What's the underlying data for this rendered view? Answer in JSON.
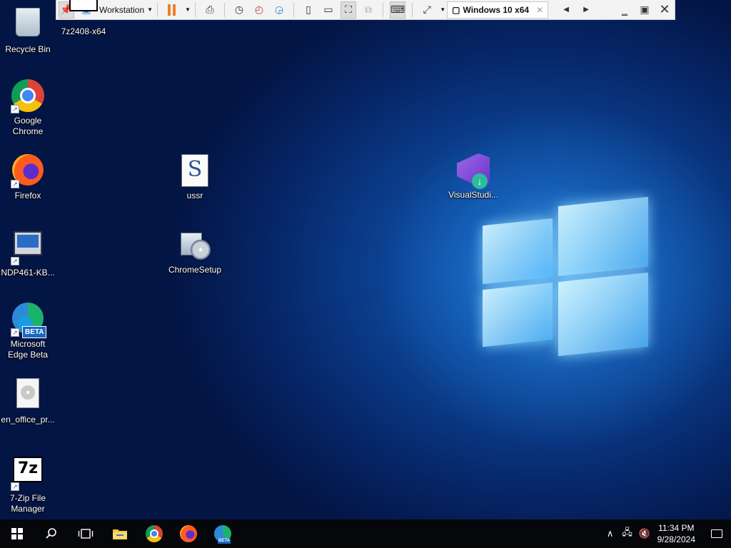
{
  "toolbar": {
    "vm_menu_label": "Workstation",
    "tab_title": "Windows 10 x64",
    "tab_close": "✕",
    "prev_glyph": "◀",
    "next_glyph": "▶"
  },
  "desktop_icons": {
    "recycle_bin": "Recycle Bin",
    "sevenzip_installer": "7z2408-x64",
    "chrome_line1": "Google",
    "chrome_line2": "Chrome",
    "firefox": "Firefox",
    "ndp": "NDP461-KB...",
    "edge_line1": "Microsoft",
    "edge_line2": "Edge Beta",
    "edge_badge": "BETA",
    "office": "en_office_pr...",
    "sevenzip_line1": "7-Zip File",
    "sevenzip_line2": "Manager",
    "sevenzip_glyph": "7z",
    "ussr": "ussr",
    "chrome_setup": "ChromeSetup",
    "visual_studio": "VisualStudi..."
  },
  "taskbar": {
    "time": "11:34 PM",
    "date": "9/28/2024",
    "edge_badge": "BETA"
  },
  "colors": {
    "taskbar_bg": "#06070b",
    "toolbar_bg": "#f3f3f3",
    "pause_orange": "#e8812a"
  }
}
